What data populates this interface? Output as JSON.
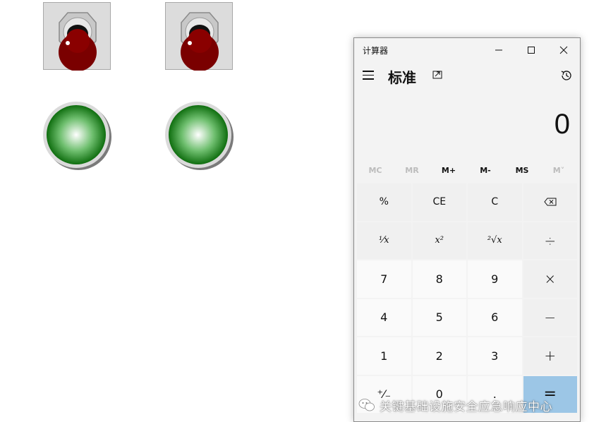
{
  "calculator": {
    "window_title": "计算器",
    "mode_title": "标准",
    "display_value": "0",
    "window_controls": {
      "minimize": "—",
      "maximize": "☐",
      "close": "✕"
    },
    "memory": [
      "MC",
      "MR",
      "M+",
      "M-",
      "MS",
      "M˅"
    ],
    "keys": [
      [
        "%",
        "CE",
        "C",
        "⌫"
      ],
      [
        "¹⁄x",
        "x²",
        "²√x",
        "÷"
      ],
      [
        "7",
        "8",
        "9",
        "×"
      ],
      [
        "4",
        "5",
        "6",
        "−"
      ],
      [
        "1",
        "2",
        "3",
        "+"
      ],
      [
        "⁺⁄₋",
        "0",
        ".",
        "="
      ]
    ],
    "colors": {
      "equals_key": "#9cc6e6",
      "window_bg": "#f3f3f3"
    }
  },
  "controls": {
    "switch_knob_color": "#7a0000",
    "lamp_color": "#1e7d1e"
  },
  "watermark": {
    "text": "关键基础设施安全应急响应中心"
  }
}
